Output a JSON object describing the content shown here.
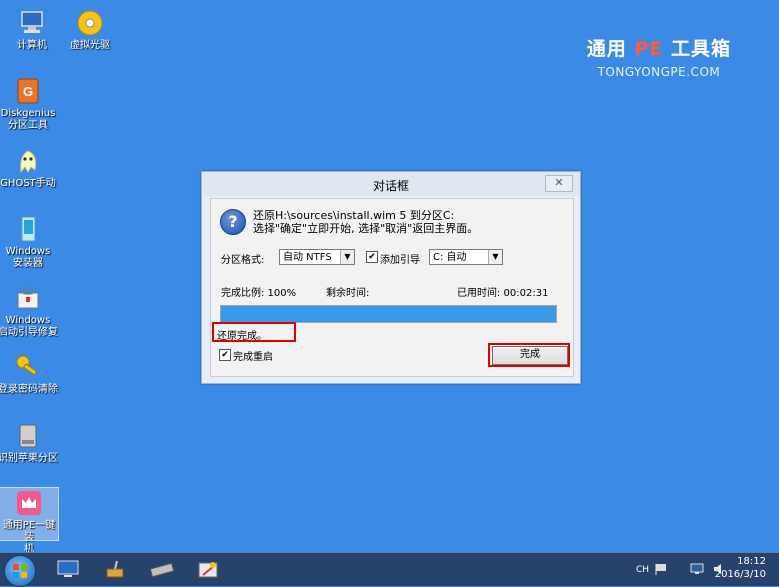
{
  "desktop": {
    "icons": [
      {
        "label": "计算机"
      },
      {
        "label": "虚拟光驱"
      },
      {
        "label": "Diskgenius\n分区工具"
      },
      {
        "label": "GHOST手动"
      },
      {
        "label": "Windows\n安装器"
      },
      {
        "label": "Windows\n启动引导修复"
      },
      {
        "label": "登录密码清除"
      },
      {
        "label": "识别苹果分区"
      },
      {
        "label": "通用PE一键装\n机"
      }
    ],
    "brand": {
      "prefix": "通用 ",
      "pe": "PE",
      "suffix": " 工具箱",
      "url": "TONGYONGPE.COM",
      "pe_color": "#ff5a3c"
    }
  },
  "dialog": {
    "title": "对话框",
    "close_label": "✕",
    "message_line1": "还原H:\\sources\\install.wim 5 到分区C:",
    "message_line2": "选择\"确定\"立即开始, 选择\"取消\"返回主界面。",
    "format_label": "分区格式:",
    "format_value": "自动 NTFS",
    "add_boot_label": "添加引导",
    "add_boot_checked": "✔",
    "boot_target_value": "C: 自动",
    "completion_label": "完成比例: 100%",
    "remaining_label": "剩余时间:",
    "elapsed_label": "已用时间: 00:02:31",
    "progress_percent": 100,
    "status_text": "还原完成。",
    "restart_label": "完成重启",
    "restart_checked": "✔",
    "finish_button": "完成",
    "highlight_color": "#e00000"
  },
  "taskbar": {
    "lang": "CH",
    "time": "18:12",
    "date": "2016/3/10"
  },
  "colors": {
    "desktop_bg": "#3a8ae6",
    "taskbar_bg": "#27426b",
    "progress_fill": "#3a9ae8"
  }
}
